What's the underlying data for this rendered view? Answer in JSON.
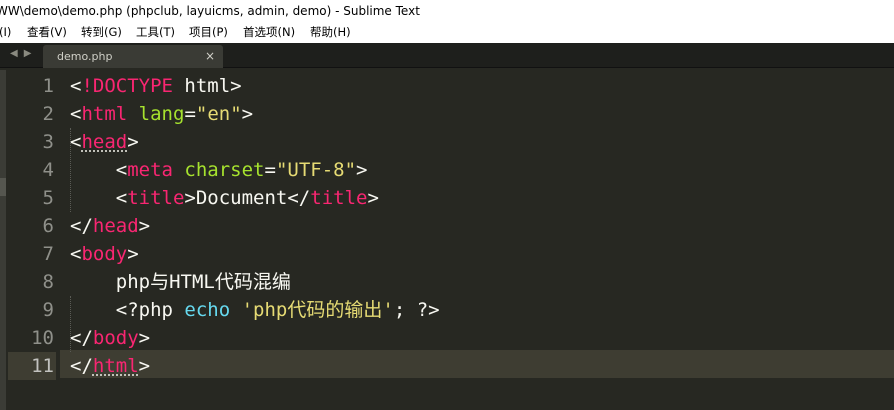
{
  "window": {
    "title": "WW\\demo\\demo.php (phpclub, layuicms, admin, demo) - Sublime Text"
  },
  "menu": [
    {
      "label": "(I)"
    },
    {
      "label": "查看(V)"
    },
    {
      "label": "转到(G)"
    },
    {
      "label": "工具(T)"
    },
    {
      "label": "项目(P)"
    },
    {
      "label": "首选项(N)"
    },
    {
      "label": "帮助(H)"
    }
  ],
  "tabbar": {
    "nav_left": "◀",
    "nav_right": "▶",
    "tab": {
      "label": "demo.php",
      "close": "×"
    }
  },
  "editor": {
    "current_line": 11,
    "line_numbers": [
      "1",
      "2",
      "3",
      "4",
      "5",
      "6",
      "7",
      "8",
      "9",
      "10",
      "11"
    ],
    "lines": [
      [
        {
          "t": "<",
          "c": "plain"
        },
        {
          "t": "!DOCTYPE",
          "c": "tag"
        },
        {
          "t": " html>",
          "c": "plain"
        }
      ],
      [
        {
          "t": "<",
          "c": "plain"
        },
        {
          "t": "html",
          "c": "tag"
        },
        {
          "t": " ",
          "c": "plain"
        },
        {
          "t": "lang",
          "c": "attr"
        },
        {
          "t": "=",
          "c": "plain"
        },
        {
          "t": "\"en\"",
          "c": "str"
        },
        {
          "t": ">",
          "c": "plain"
        }
      ],
      [
        {
          "t": "<",
          "c": "plain"
        },
        {
          "t": "head",
          "c": "tag"
        },
        {
          "t": ">",
          "c": "plain"
        }
      ],
      [
        {
          "t": "    <",
          "c": "plain"
        },
        {
          "t": "meta",
          "c": "tag"
        },
        {
          "t": " ",
          "c": "plain"
        },
        {
          "t": "charset",
          "c": "attr"
        },
        {
          "t": "=",
          "c": "plain"
        },
        {
          "t": "\"UTF-8\"",
          "c": "str"
        },
        {
          "t": ">",
          "c": "plain"
        }
      ],
      [
        {
          "t": "    <",
          "c": "plain"
        },
        {
          "t": "title",
          "c": "tag"
        },
        {
          "t": ">Document</",
          "c": "plain"
        },
        {
          "t": "title",
          "c": "tag"
        },
        {
          "t": ">",
          "c": "plain"
        }
      ],
      [
        {
          "t": "</",
          "c": "plain"
        },
        {
          "t": "head",
          "c": "tag"
        },
        {
          "t": ">",
          "c": "plain"
        }
      ],
      [
        {
          "t": "<",
          "c": "plain"
        },
        {
          "t": "body",
          "c": "tag"
        },
        {
          "t": ">",
          "c": "plain"
        }
      ],
      [
        {
          "t": "    php与HTML代码混编",
          "c": "plain"
        }
      ],
      [
        {
          "t": "    <?php ",
          "c": "plain"
        },
        {
          "t": "echo",
          "c": "kw"
        },
        {
          "t": " ",
          "c": "plain"
        },
        {
          "t": "'php代码的输出'",
          "c": "str"
        },
        {
          "t": "; ?>",
          "c": "plain"
        }
      ],
      [
        {
          "t": "</",
          "c": "plain"
        },
        {
          "t": "body",
          "c": "tag"
        },
        {
          "t": ">",
          "c": "plain"
        }
      ],
      [
        {
          "t": "</",
          "c": "plain"
        },
        {
          "t": "html",
          "c": "tag"
        },
        {
          "t": ">",
          "c": "plain"
        }
      ]
    ]
  }
}
